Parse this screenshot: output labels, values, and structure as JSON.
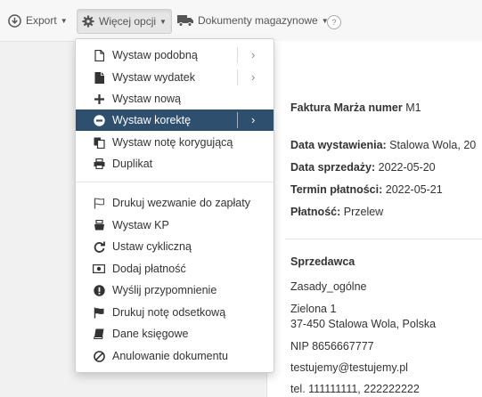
{
  "toolbar": {
    "export_label": "Export",
    "more_label": "Więcej opcji",
    "warehouse_label": "Dokumenty magazynowe",
    "help_label": "?"
  },
  "menu": {
    "items": [
      {
        "label": "Wystaw podobną",
        "icon": "document-icon",
        "submenu": true
      },
      {
        "label": "Wystaw wydatek",
        "icon": "document-filled-icon",
        "submenu": true
      },
      {
        "label": "Wystaw nową",
        "icon": "plus-icon",
        "submenu": false
      },
      {
        "label": "Wystaw korektę",
        "icon": "minus-circle-icon",
        "submenu": true,
        "active": true
      },
      {
        "label": "Wystaw notę korygującą",
        "icon": "copy-icon",
        "submenu": false
      },
      {
        "label": "Duplikat",
        "icon": "print-icon",
        "submenu": false
      },
      {
        "label": "Drukuj wezwanie do zapłaty",
        "icon": "flag-outline-icon",
        "submenu": false
      },
      {
        "label": "Wystaw KP",
        "icon": "cash-register-icon",
        "submenu": false
      },
      {
        "label": "Ustaw cykliczną",
        "icon": "refresh-icon",
        "submenu": false
      },
      {
        "label": "Dodaj płatność",
        "icon": "banknote-icon",
        "submenu": false
      },
      {
        "label": "Wyślij przypomnienie",
        "icon": "exclamation-circle-icon",
        "submenu": false
      },
      {
        "label": "Drukuj notę odsetkową",
        "icon": "flag-icon",
        "submenu": false
      },
      {
        "label": "Dane księgowe",
        "icon": "book-icon",
        "submenu": false
      },
      {
        "label": "Anulowanie dokumentu",
        "icon": "ban-icon",
        "submenu": false
      }
    ]
  },
  "invoice": {
    "title_bold": "Faktura Marża numer",
    "number": "M1",
    "issue_label": "Data wystawienia:",
    "issue_value": "Stalowa Wola, 20",
    "sale_label": "Data sprzedaży:",
    "sale_value": "2022-05-20",
    "due_label": "Termin płatności:",
    "due_value": "2022-05-21",
    "payment_label": "Płatność:",
    "payment_value": "Przelew",
    "seller_heading": "Sprzedawca",
    "seller_name": "Zasady_ogólne",
    "seller_street": "Zielona 1",
    "seller_city": "37-450 Stalowa Wola, Polska",
    "seller_nip": "NIP 8656667777",
    "seller_email": "testujemy@testujemy.pl",
    "seller_phone": "tel. 111111111, 222222222"
  },
  "colors": {
    "menu_active_bg": "#2f4f6f",
    "toolbar_bg": "#f7f7f7"
  }
}
